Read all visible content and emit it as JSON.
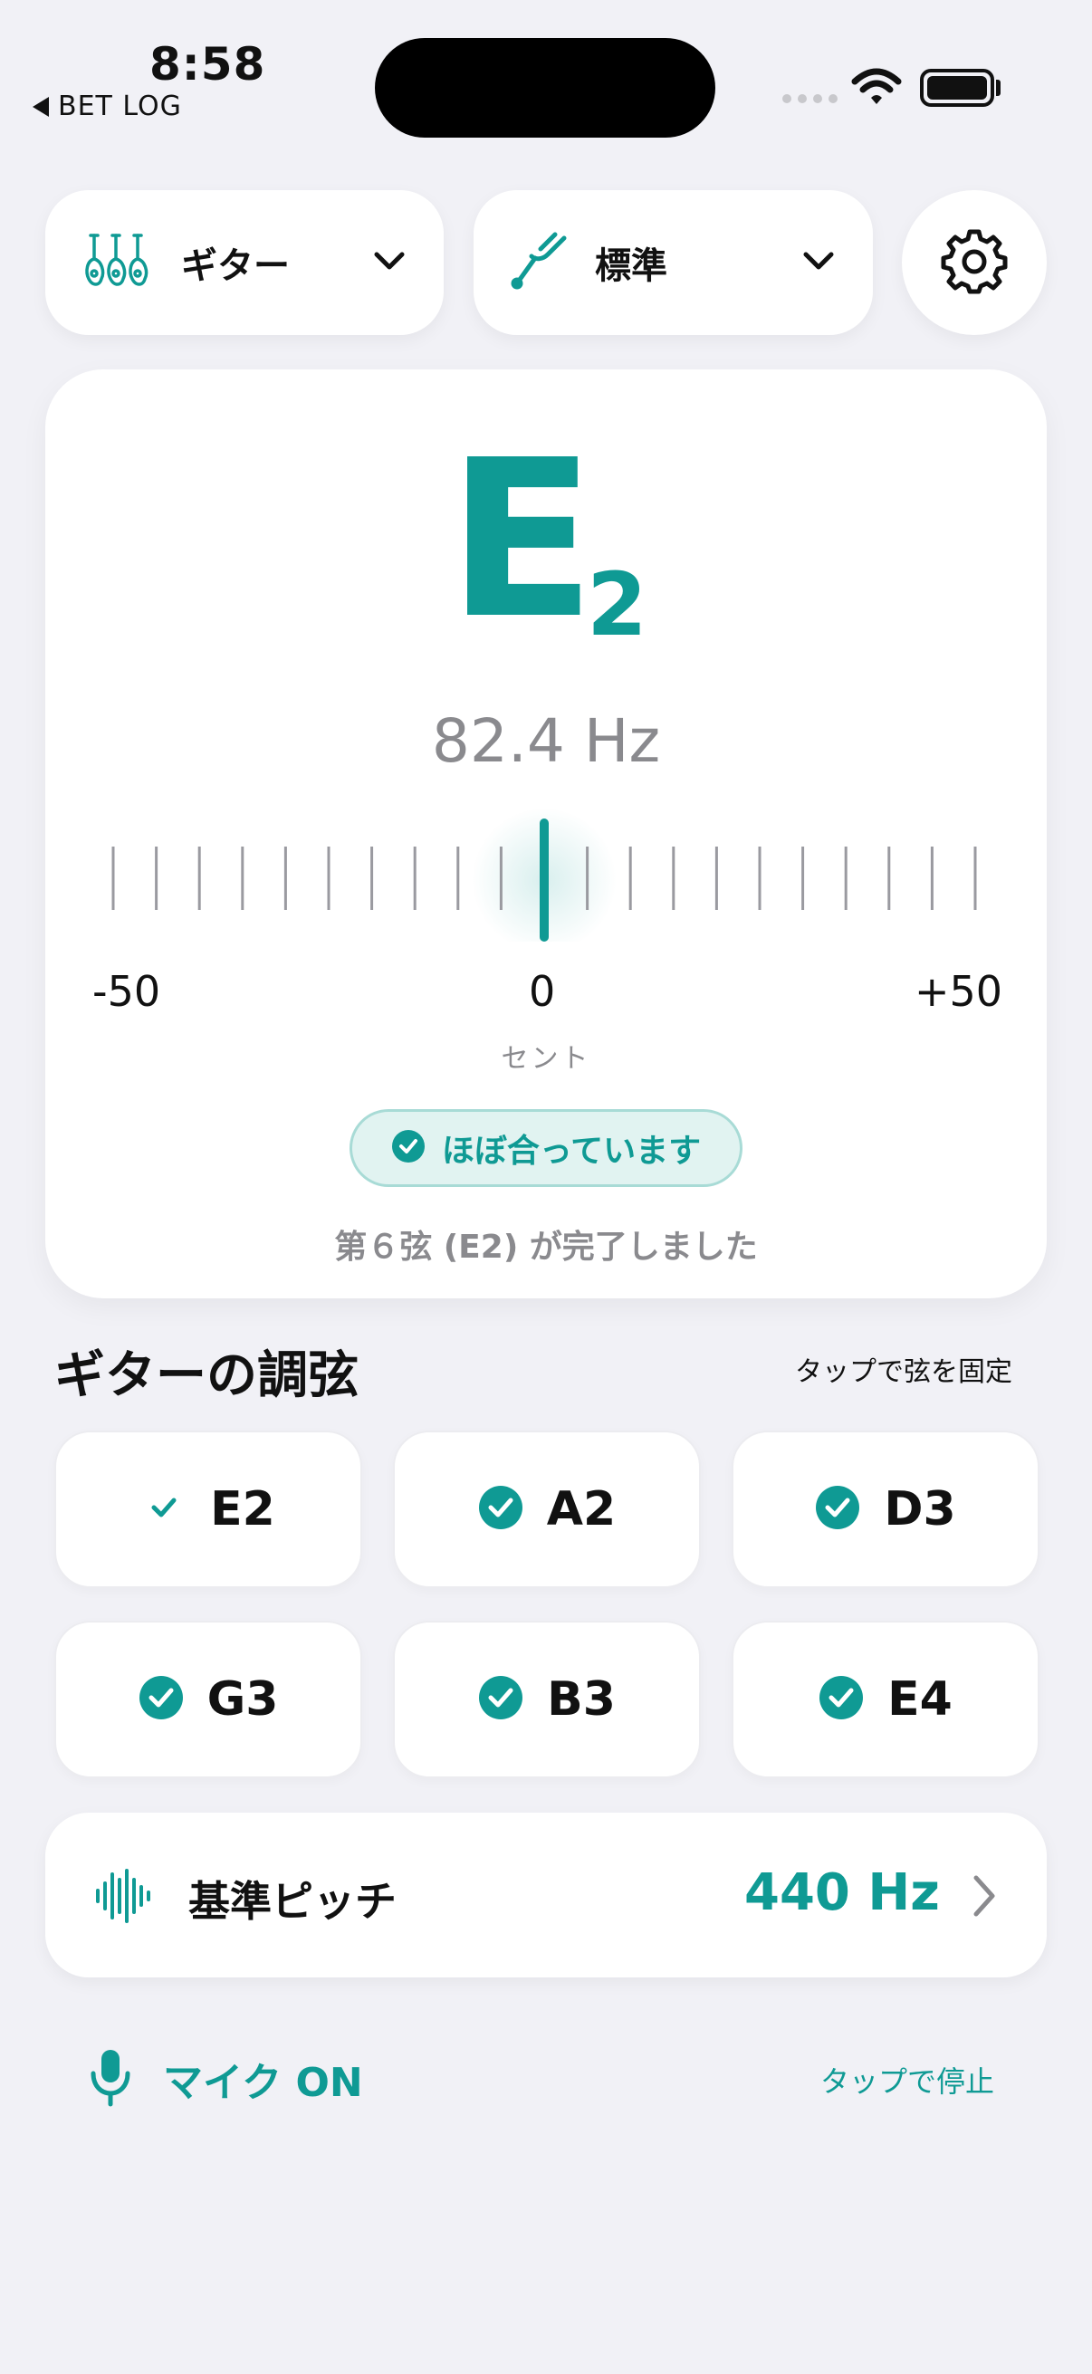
{
  "status_bar": {
    "time": "8:58",
    "back_label": "BET LOG"
  },
  "selectors": {
    "instrument": {
      "label": "ギター",
      "icon": "instruments-icon"
    },
    "tuning": {
      "label": "標準",
      "icon": "tuning-fork-icon"
    },
    "settings_icon": "gear-icon"
  },
  "tuner": {
    "note": "E",
    "octave": "2",
    "frequency": "82.4 Hz",
    "cents_offset": 0,
    "scale_min": "-50",
    "scale_zero": "0",
    "scale_max": "+50",
    "cents_label": "セント",
    "status": "ほぼ合っています",
    "completion_message": "第６弦 (E2) が完了しました"
  },
  "strings_section": {
    "title": "ギターの調弦",
    "hint": "タップで弦を固定",
    "strings": [
      {
        "label": "E2",
        "done": true,
        "active": true
      },
      {
        "label": "A2",
        "done": true,
        "active": false
      },
      {
        "label": "D3",
        "done": true,
        "active": false
      },
      {
        "label": "G3",
        "done": true,
        "active": false
      },
      {
        "label": "B3",
        "done": true,
        "active": false
      },
      {
        "label": "E4",
        "done": true,
        "active": false
      }
    ]
  },
  "reference_pitch": {
    "label": "基準ピッチ",
    "value": "440 Hz"
  },
  "mic": {
    "label": "マイク ON",
    "hint": "タップで停止"
  },
  "colors": {
    "accent": "#0f9a94",
    "background": "#f1f1f6",
    "muted": "#8a8a8e"
  }
}
